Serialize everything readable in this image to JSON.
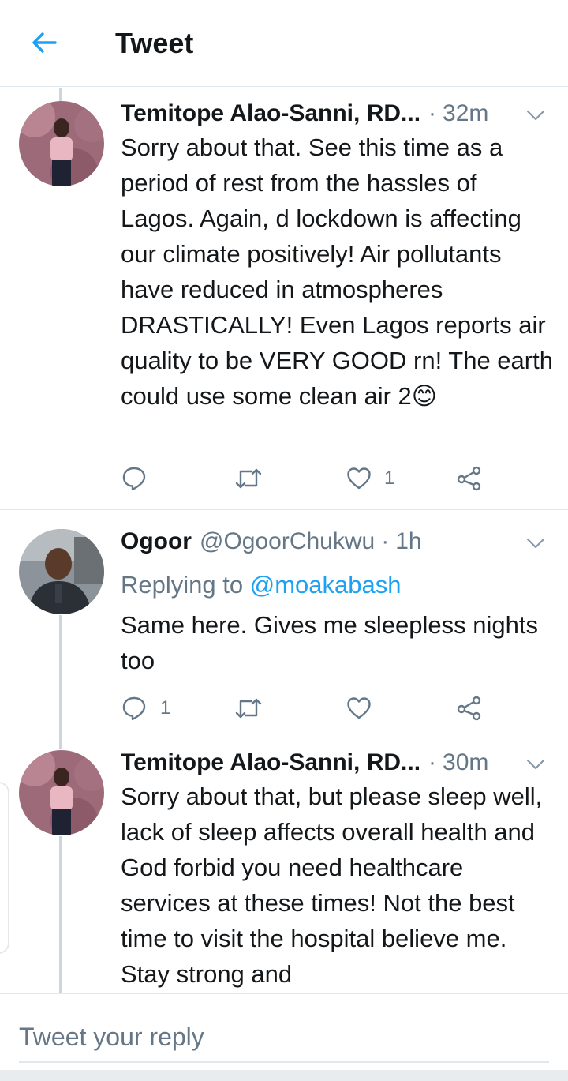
{
  "header": {
    "back_icon": "arrow-left-icon",
    "title": "Tweet"
  },
  "colors": {
    "accent": "#1da1f2",
    "secondary_text": "#657786",
    "divider": "#e1e8ed"
  },
  "tweets": [
    {
      "author": "Temitope Alao-Sanni, RD...",
      "handle": "",
      "dot": "·",
      "time": "32m",
      "reply_prefix": "",
      "reply_mention": "",
      "text": "Sorry about that. See this time as a period of rest from the hassles of Lagos. Again, d lockdown is affecting our climate positively! Air pollutants have reduced in atmospheres DRASTICALLY! Even Lagos reports air quality to be VERY GOOD rn! The earth could use some clean air 2😊",
      "reply_count": "",
      "retweet_count": "",
      "like_count": "1"
    },
    {
      "author": "Ogoor",
      "handle": "@OgoorChukwu",
      "dot": "·",
      "time": "1h",
      "reply_prefix": "Replying to",
      "reply_mention": "@moakabash",
      "text": "Same here. Gives me sleepless nights too",
      "reply_count": "1",
      "retweet_count": "",
      "like_count": ""
    },
    {
      "author": "Temitope Alao-Sanni, RD...",
      "handle": "",
      "dot": "·",
      "time": "30m",
      "reply_prefix": "",
      "reply_mention": "",
      "text": "Sorry about that, but please sleep well, lack of sleep affects overall health and God forbid you need healthcare services at these times! Not the best time to visit the hospital believe me. Stay strong and",
      "reply_count": "",
      "retweet_count": "",
      "like_count": ""
    }
  ],
  "reply_box": {
    "placeholder": "Tweet your reply"
  }
}
